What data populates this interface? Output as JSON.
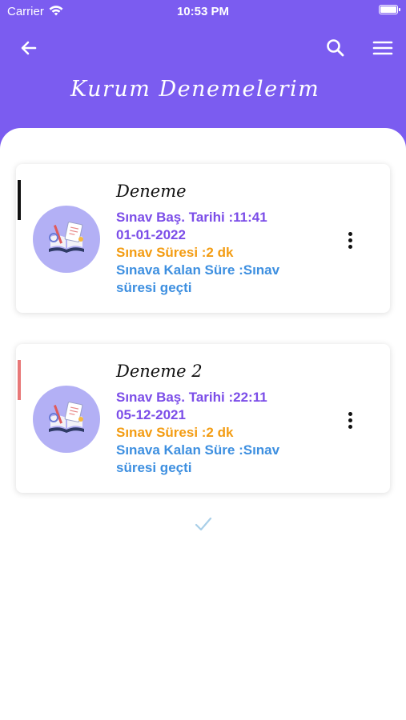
{
  "status_bar": {
    "carrier": "Carrier",
    "time": "10:53 PM"
  },
  "header": {
    "title": "Kurum Denemelerim",
    "back_icon": "arrow-left-icon",
    "search_icon": "search-icon",
    "menu_icon": "hamburger-menu-icon",
    "background_color": "#7b5cf0"
  },
  "exams": [
    {
      "title": "Deneme",
      "start_line1": "Sınav Baş. Tarihi :11:41",
      "start_line2": "01-01-2022",
      "duration": "Sınav Süresi :2 dk",
      "remaining_line1": "Sınava Kalan Süre :Sınav",
      "remaining_line2": "süresi geçti",
      "accent_color": "#111111"
    },
    {
      "title": "Deneme 2",
      "start_line1": "Sınav Baş. Tarihi :22:11",
      "start_line2": "05-12-2021",
      "duration": "Sınav Süresi :2 dk",
      "remaining_line1": "Sınava Kalan Süre :Sınav",
      "remaining_line2": "süresi geçti",
      "accent_color": "#e87878"
    }
  ],
  "colors": {
    "start_text": "#7b4de8",
    "duration_text": "#f39c12",
    "remaining_text": "#3d8fe0",
    "thumb_bg": "#b3b0f5",
    "checkmark": "#a9cfe8"
  },
  "footer": {
    "check_icon": "checkmark-icon"
  }
}
